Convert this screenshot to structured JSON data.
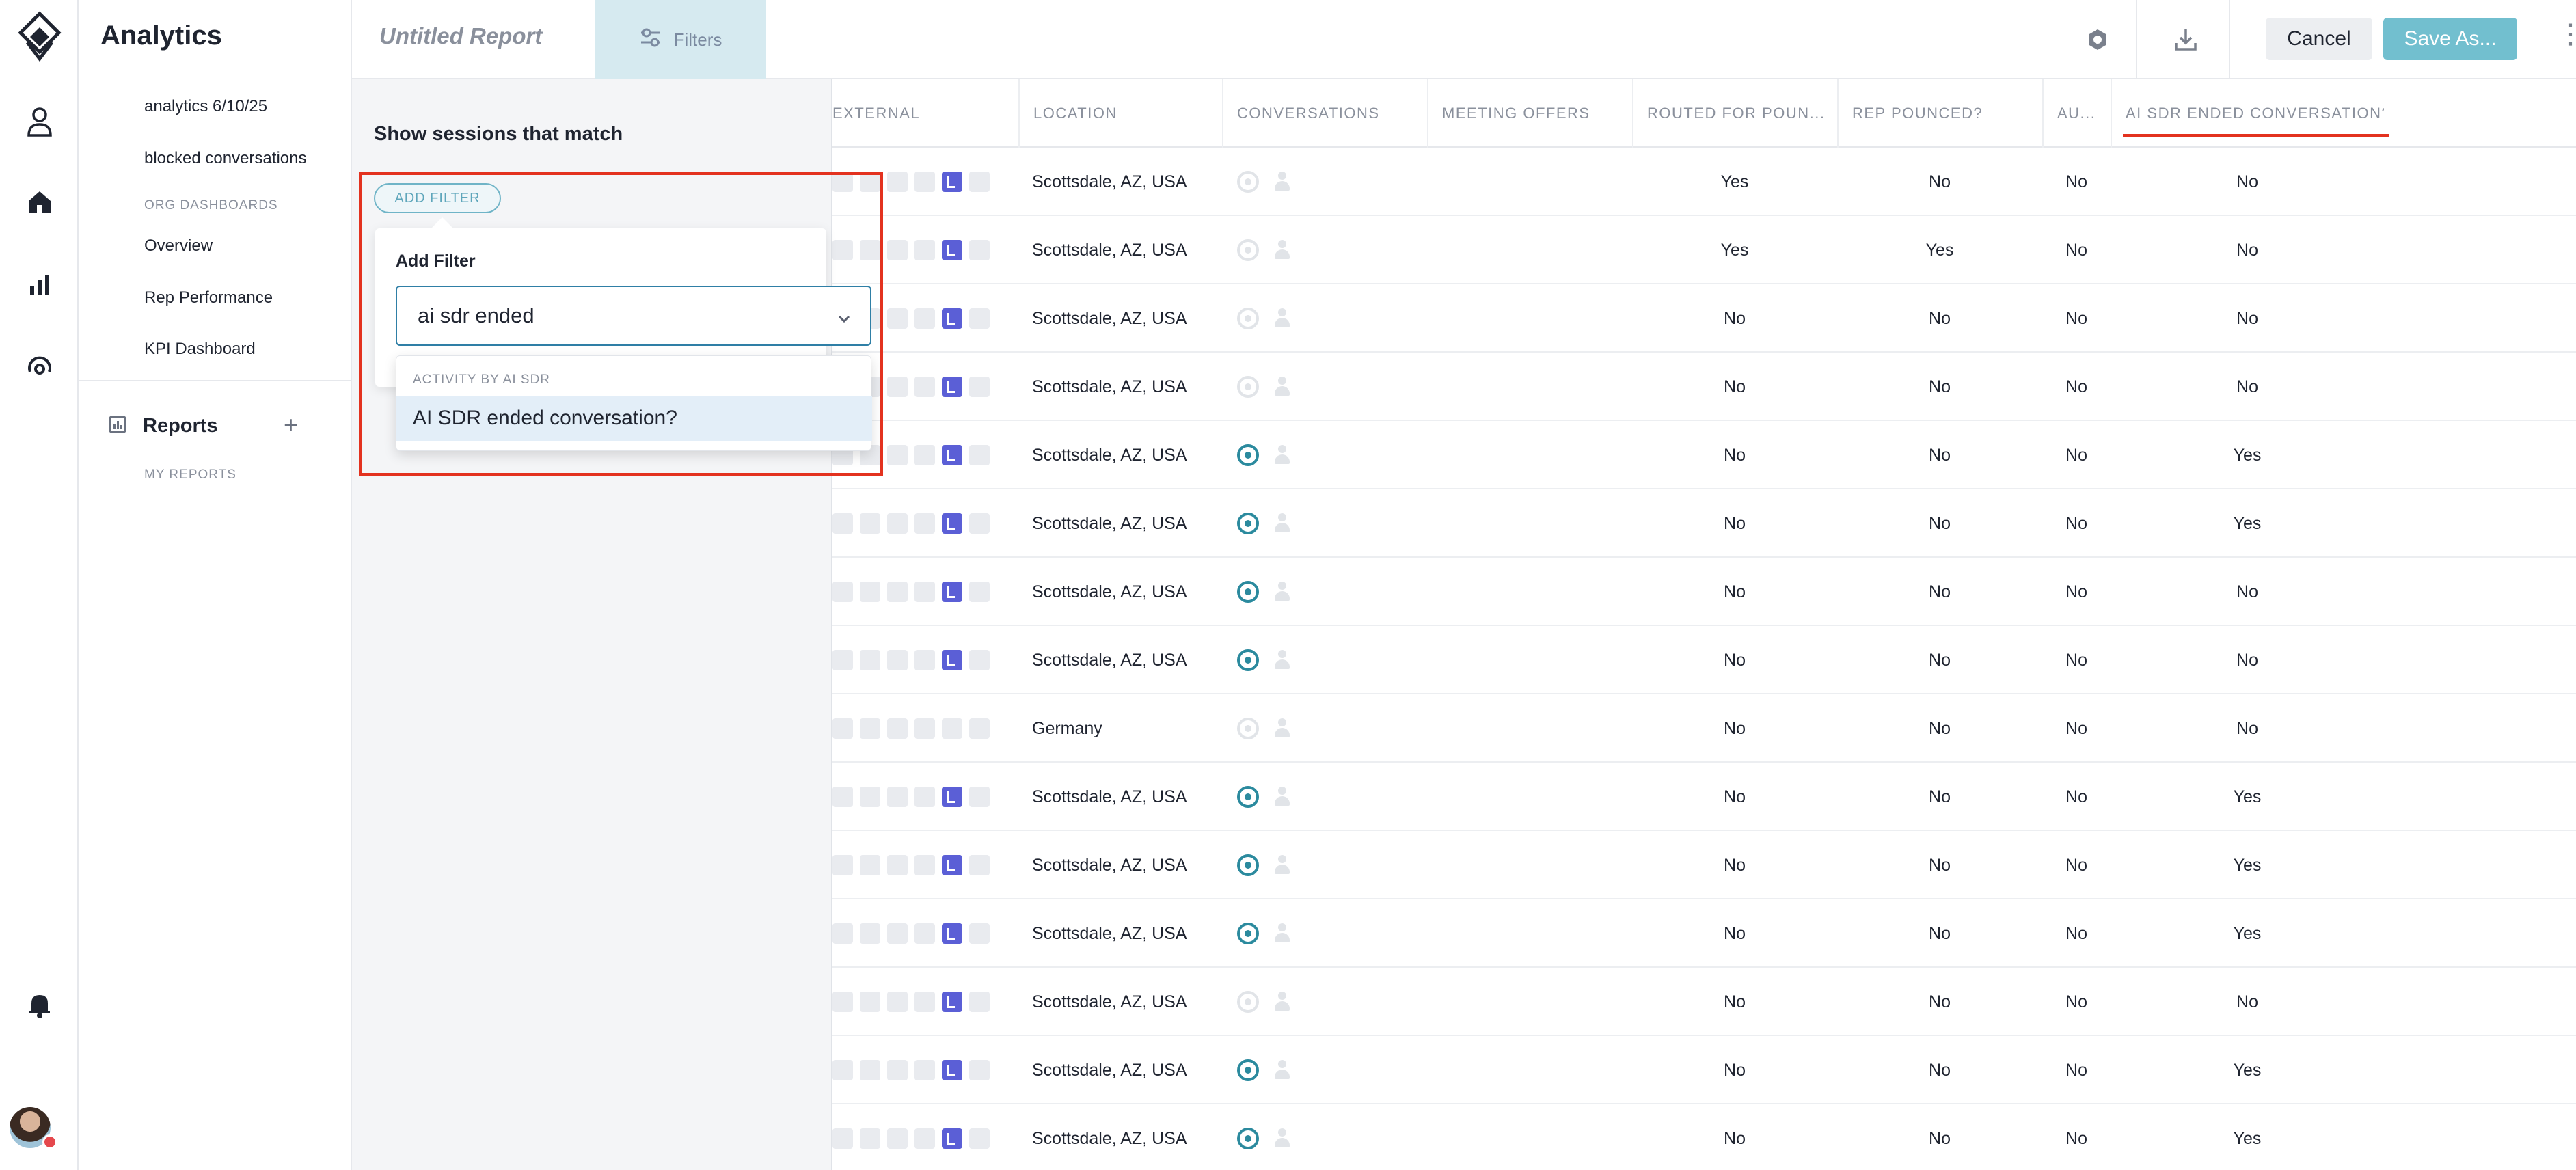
{
  "app": {
    "title": "Analytics"
  },
  "nav": {
    "items": [
      {
        "label": "analytics 6/10/25"
      },
      {
        "label": "blocked conversations"
      }
    ],
    "org_dashboards_label": "ORG DASHBOARDS",
    "org_items": [
      {
        "label": "Overview"
      },
      {
        "label": "Rep Performance"
      },
      {
        "label": "KPI Dashboard"
      }
    ],
    "reports_label": "Reports",
    "reports_add": "+",
    "my_reports_label": "MY REPORTS"
  },
  "topbar": {
    "report_title": "Untitled Report",
    "filters_tab": "Filters",
    "cancel_label": "Cancel",
    "save_label": "Save As...",
    "more": "⋮"
  },
  "filters": {
    "title": "Show sessions that match",
    "add_filter_pill": "ADD FILTER",
    "card_title": "Add Filter",
    "search_value": "ai sdr ended",
    "group_label": "ACTIVITY BY AI SDR",
    "option_label": "AI SDR ended conversation?"
  },
  "table": {
    "columns": [
      {
        "label": "EXTERNAL"
      },
      {
        "label": "LOCATION"
      },
      {
        "label": "CONVERSATIONS"
      },
      {
        "label": "MEETING OFFERS"
      },
      {
        "label": "ROUTED FOR POUN..."
      },
      {
        "label": "REP POUNCED?"
      },
      {
        "label": "AU..."
      },
      {
        "label": "AI SDR ENDED CONVERSATION?"
      }
    ],
    "rows": [
      {
        "location": "Scottsdale, AZ, USA",
        "conv_active": false,
        "routed": "Yes",
        "pounced": "No",
        "au": "No",
        "ended": "No"
      },
      {
        "location": "Scottsdale, AZ, USA",
        "conv_active": false,
        "routed": "Yes",
        "pounced": "Yes",
        "au": "No",
        "ended": "No"
      },
      {
        "location": "Scottsdale, AZ, USA",
        "conv_active": false,
        "routed": "No",
        "pounced": "No",
        "au": "No",
        "ended": "No"
      },
      {
        "location": "Scottsdale, AZ, USA",
        "conv_active": false,
        "routed": "No",
        "pounced": "No",
        "au": "No",
        "ended": "No"
      },
      {
        "location": "Scottsdale, AZ, USA",
        "conv_active": true,
        "routed": "No",
        "pounced": "No",
        "au": "No",
        "ended": "Yes"
      },
      {
        "location": "Scottsdale, AZ, USA",
        "conv_active": true,
        "routed": "No",
        "pounced": "No",
        "au": "No",
        "ended": "Yes"
      },
      {
        "location": "Scottsdale, AZ, USA",
        "conv_active": true,
        "routed": "No",
        "pounced": "No",
        "au": "No",
        "ended": "No"
      },
      {
        "location": "Scottsdale, AZ, USA",
        "conv_active": true,
        "routed": "No",
        "pounced": "No",
        "au": "No",
        "ended": "No"
      },
      {
        "location": "Germany",
        "conv_active": false,
        "routed": "No",
        "pounced": "No",
        "au": "No",
        "ended": "No"
      },
      {
        "location": "Scottsdale, AZ, USA",
        "conv_active": true,
        "routed": "No",
        "pounced": "No",
        "au": "No",
        "ended": "Yes"
      },
      {
        "location": "Scottsdale, AZ, USA",
        "conv_active": true,
        "routed": "No",
        "pounced": "No",
        "au": "No",
        "ended": "Yes"
      },
      {
        "location": "Scottsdale, AZ, USA",
        "conv_active": true,
        "routed": "No",
        "pounced": "No",
        "au": "No",
        "ended": "Yes"
      },
      {
        "location": "Scottsdale, AZ, USA",
        "conv_active": false,
        "routed": "No",
        "pounced": "No",
        "au": "No",
        "ended": "No"
      },
      {
        "location": "Scottsdale, AZ, USA",
        "conv_active": true,
        "routed": "No",
        "pounced": "No",
        "au": "No",
        "ended": "Yes"
      },
      {
        "location": "Scottsdale, AZ, USA",
        "conv_active": true,
        "routed": "No",
        "pounced": "No",
        "au": "No",
        "ended": "Yes"
      }
    ]
  },
  "icons": {
    "rail": [
      "logo-icon",
      "profile-icon",
      "home-icon",
      "bar-chart-icon",
      "radar-icon",
      "bell-icon"
    ],
    "topbar": [
      "settings-icon",
      "download-icon",
      "sliders-icon",
      "more-icon"
    ]
  },
  "colors": {
    "accent": "#72bfcf",
    "filters_tab_bg": "#d6eaf0",
    "highlight": "#e3321f",
    "active_target": "#2b8a9e",
    "indigo_square": "#5b5fd6"
  }
}
